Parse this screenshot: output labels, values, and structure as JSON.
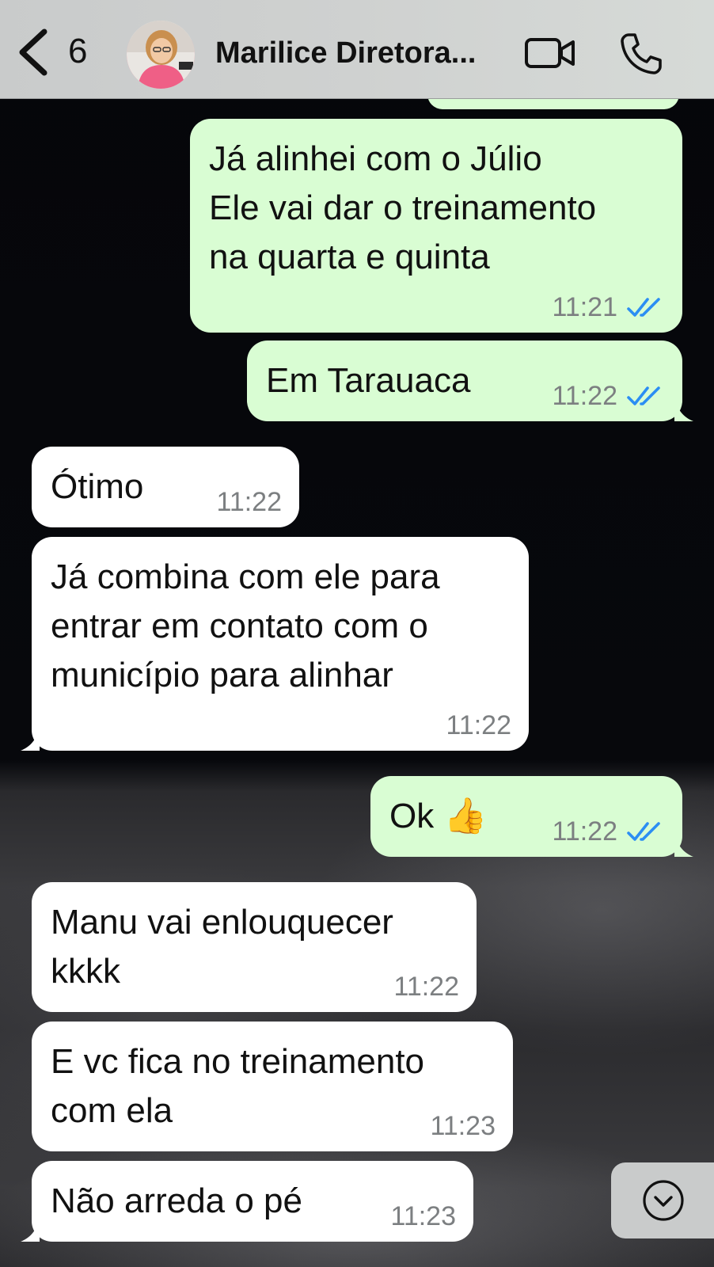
{
  "header": {
    "unread_count": "6",
    "contact_name": "Marilice Diretora..."
  },
  "icons": {
    "back": "chevron-left-icon",
    "video": "video-camera-icon",
    "call": "phone-icon",
    "read": "double-check-icon",
    "scroll": "chevron-down-circle-icon"
  },
  "colors": {
    "outgoing_bubble": "#d9fdd3",
    "incoming_bubble": "#ffffff",
    "read_tick": "#2b8ef3"
  },
  "messages": [
    {
      "direction": "out",
      "text": "Já alinhei com o Júlio\nEle vai dar o treinamento\nna quarta e quinta",
      "time": "11:21",
      "read": true
    },
    {
      "direction": "out",
      "text": "Em Tarauaca",
      "time": "11:22",
      "read": true
    },
    {
      "direction": "in",
      "text": "Ótimo",
      "time": "11:22"
    },
    {
      "direction": "in",
      "text": "Já combina com ele para\nentrar em contato com o\nmunicípio para alinhar",
      "time": "11:22"
    },
    {
      "direction": "out",
      "text": "Ok 👍",
      "time": "11:22",
      "read": true
    },
    {
      "direction": "in",
      "text": "Manu vai enlouquecer\nkkkk",
      "time": "11:22"
    },
    {
      "direction": "in",
      "text": "E vc fica no treinamento\ncom ela",
      "time": "11:23"
    },
    {
      "direction": "in",
      "text": "Não arreda o pé",
      "time": "11:23"
    }
  ]
}
